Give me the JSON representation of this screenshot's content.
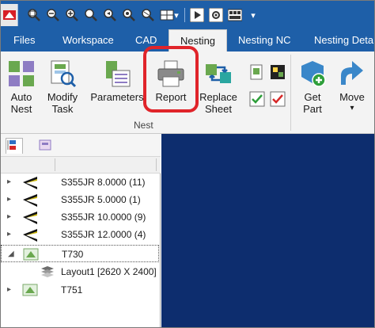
{
  "qat": {
    "icons": [
      "zoom-extents-icon",
      "zoom-out-icon",
      "zoom-in-icon",
      "zoom-window-icon",
      "zoom-previous-icon",
      "zoom-all-icon",
      "grid-select-icon",
      "play-icon",
      "settings-icon",
      "layout-icon"
    ],
    "dropdown_glyph": "▾"
  },
  "tabs": {
    "files": "Files",
    "workspace": "Workspace",
    "cad": "CAD",
    "nesting": "Nesting",
    "nesting_nc": "Nesting NC",
    "nesting_details": "Nesting Detai"
  },
  "ribbon": {
    "auto_nest": "Auto\nNest",
    "modify_task": "Modify\nTask",
    "parameters": "Parameters",
    "report": "Report",
    "replace_sheet": "Replace\nSheet",
    "get_part": "Get\nPart",
    "move": "Move",
    "move_dropdown": "▾",
    "group_label": "Nest"
  },
  "tree": {
    "rows": [
      {
        "label": "S355JR 8.0000 (11)",
        "icon": "material-sheet-icon",
        "expand": "▸"
      },
      {
        "label": "S355JR 5.0000 (1)",
        "icon": "material-sheet-icon",
        "expand": "▸"
      },
      {
        "label": "S355JR 10.0000 (9)",
        "icon": "material-sheet-icon",
        "expand": "▸"
      },
      {
        "label": "S355JR 12.0000 (4)",
        "icon": "material-sheet-icon",
        "expand": "▸"
      },
      {
        "label": "T730",
        "icon": "nest-task-icon",
        "expand": "◢"
      },
      {
        "label": "Layout1 [2620 X 2400]",
        "icon": "layout-stack-icon",
        "expand": ""
      },
      {
        "label": "T751",
        "icon": "nest-task-icon",
        "expand": "▸"
      }
    ]
  },
  "colors": {
    "accent_blue": "#1e5fa8",
    "workspace": "#0d2d6e",
    "highlight_red": "#e0242a"
  }
}
